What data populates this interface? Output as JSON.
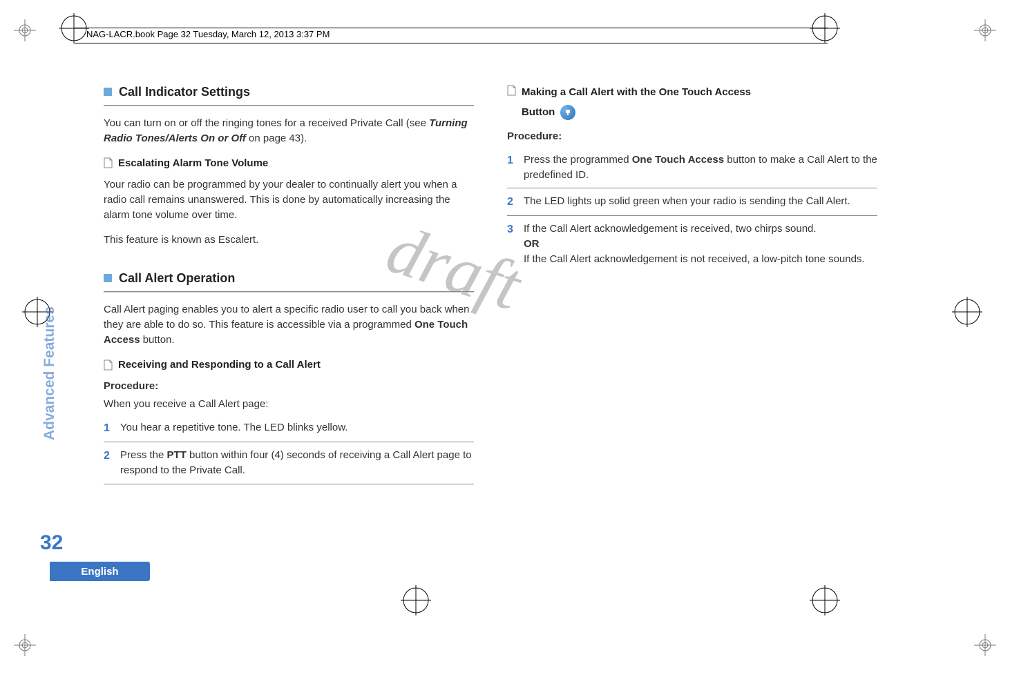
{
  "header_line": "NAG-LACR.book  Page 32  Tuesday, March 12, 2013  3:37 PM",
  "sidebar_label": "Advanced Features",
  "page_number": "32",
  "language": "English",
  "watermark": "draft",
  "left": {
    "section1": {
      "title": "Call Indicator Settings",
      "p1_a": "You can turn on or off the ringing tones for a received Private Call (see ",
      "p1_b": "Turning Radio Tones/Alerts On or Off",
      "p1_c": " on page 43).",
      "sub1": "Escalating Alarm Tone Volume",
      "p2": "Your radio can be programmed by your dealer to continually alert you when a radio call remains unanswered. This is done by automatically increasing the alarm tone volume over time.",
      "p3": "This feature is known as Escalert."
    },
    "section2": {
      "title": "Call Alert Operation",
      "p1_a": "Call Alert paging enables you to alert a specific radio user to call you back when they are able to do so. This feature is accessible via a programmed ",
      "p1_b": "One Touch Access",
      "p1_c": " button.",
      "sub1": "Receiving and Responding to a Call Alert",
      "proc": "Procedure:",
      "proc_sub": "When you receive a Call Alert page:",
      "steps": [
        {
          "n": "1",
          "a": "You hear a repetitive tone. The LED blinks yellow."
        },
        {
          "n": "2",
          "a": "Press the ",
          "b": "PTT",
          "c": " button within four (4) seconds of receiving a Call Alert page to respond to the Private Call."
        }
      ]
    }
  },
  "right": {
    "sub1_a": "Making a Call Alert with the One Touch Access",
    "sub1_b": "Button",
    "proc": "Procedure:",
    "steps": [
      {
        "n": "1",
        "a": "Press the programmed ",
        "b": "One Touch Access",
        "c": " button to make a Call Alert to the predefined ID."
      },
      {
        "n": "2",
        "a": "The LED lights up solid green when your radio is sending the Call Alert."
      },
      {
        "n": "3",
        "a": "If the Call Alert acknowledgement is received, two chirps sound.",
        "or": "OR",
        "d": "If the Call Alert acknowledgement is not received, a low-pitch tone sounds."
      }
    ]
  }
}
